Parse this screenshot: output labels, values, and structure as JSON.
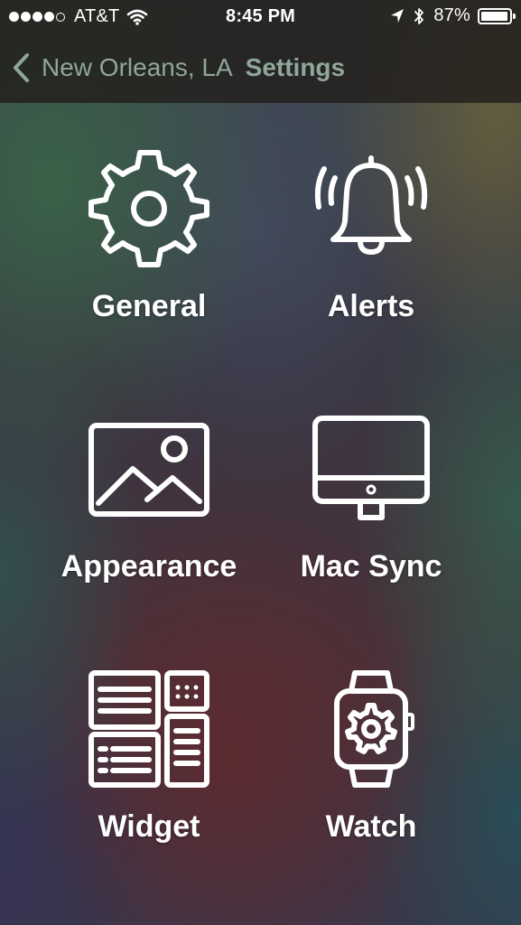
{
  "status_bar": {
    "carrier": "AT&T",
    "time": "8:45 PM",
    "battery": "87%"
  },
  "nav": {
    "back_label": "New Orleans, LA",
    "title": "Settings"
  },
  "tiles": [
    {
      "label": "General",
      "icon": "gear-icon"
    },
    {
      "label": "Alerts",
      "icon": "bell-icon"
    },
    {
      "label": "Appearance",
      "icon": "image-icon"
    },
    {
      "label": "Mac Sync",
      "icon": "monitor-icon"
    },
    {
      "label": "Widget",
      "icon": "widget-icon"
    },
    {
      "label": "Watch",
      "icon": "watch-icon"
    }
  ],
  "colors": {
    "nav_accent": "#8fa79a",
    "icon": "#ffffff"
  }
}
